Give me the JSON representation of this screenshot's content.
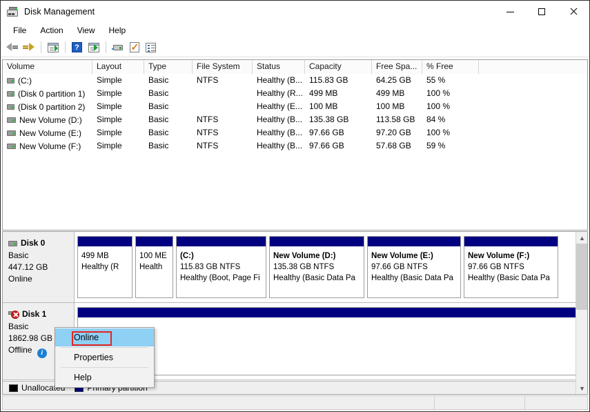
{
  "window": {
    "title": "Disk Management",
    "icon": "disk-management-icon",
    "buttons": {
      "minimize": "—",
      "maximize": "□",
      "close": "✕"
    }
  },
  "menubar": {
    "items": [
      "File",
      "Action",
      "View",
      "Help"
    ]
  },
  "toolbar": {
    "items": [
      {
        "name": "back-arrow-icon",
        "label": "Back"
      },
      {
        "name": "forward-arrow-icon",
        "label": "Forward"
      },
      {
        "name": "up-one-level-icon",
        "label": "Up One Level"
      },
      {
        "name": "help-icon",
        "label": "?"
      },
      {
        "name": "show-hide-console-tree-icon",
        "label": "Show/Hide Console Tree"
      },
      {
        "name": "disk-icon",
        "label": "Disk"
      },
      {
        "name": "rescan-disks-icon",
        "label": "Rescan Disks"
      },
      {
        "name": "properties-icon",
        "label": "Properties"
      }
    ]
  },
  "volume_list": {
    "columns": [
      "Volume",
      "Layout",
      "Type",
      "File System",
      "Status",
      "Capacity",
      "Free Spa...",
      "% Free",
      ""
    ],
    "rows": [
      {
        "volume": "(C:)",
        "layout": "Simple",
        "type": "Basic",
        "fs": "NTFS",
        "status": "Healthy (B...",
        "capacity": "115.83 GB",
        "free": "64.25 GB",
        "pct": "55 %"
      },
      {
        "volume": "(Disk 0 partition 1)",
        "layout": "Simple",
        "type": "Basic",
        "fs": "",
        "status": "Healthy (R...",
        "capacity": "499 MB",
        "free": "499 MB",
        "pct": "100 %"
      },
      {
        "volume": "(Disk 0 partition 2)",
        "layout": "Simple",
        "type": "Basic",
        "fs": "",
        "status": "Healthy (E...",
        "capacity": "100 MB",
        "free": "100 MB",
        "pct": "100 %"
      },
      {
        "volume": "New Volume (D:)",
        "layout": "Simple",
        "type": "Basic",
        "fs": "NTFS",
        "status": "Healthy (B...",
        "capacity": "135.38 GB",
        "free": "113.58 GB",
        "pct": "84 %"
      },
      {
        "volume": "New Volume (E:)",
        "layout": "Simple",
        "type": "Basic",
        "fs": "NTFS",
        "status": "Healthy (B...",
        "capacity": "97.66 GB",
        "free": "97.20 GB",
        "pct": "100 %"
      },
      {
        "volume": "New Volume (F:)",
        "layout": "Simple",
        "type": "Basic",
        "fs": "NTFS",
        "status": "Healthy (B...",
        "capacity": "97.66 GB",
        "free": "57.68 GB",
        "pct": "59 %"
      }
    ]
  },
  "graphical_view": {
    "disks": [
      {
        "name": "Disk 0",
        "type": "Basic",
        "size": "447.12 GB",
        "state": "Online",
        "icon": "disk-icon",
        "partitions": [
          {
            "name": "",
            "size": "499 MB",
            "status": "Healthy (R"
          },
          {
            "name": "",
            "size": "100 ME",
            "status": "Health"
          },
          {
            "name": "(C:)",
            "size": "115.83 GB NTFS",
            "status": "Healthy (Boot, Page Fi"
          },
          {
            "name": "New Volume  (D:)",
            "size": "135.38 GB NTFS",
            "status": "Healthy (Basic Data Pa"
          },
          {
            "name": "New Volume  (E:)",
            "size": "97.66 GB NTFS",
            "status": "Healthy (Basic Data Pa"
          },
          {
            "name": "New Volume  (F:)",
            "size": "97.66 GB NTFS",
            "status": "Healthy (Basic Data Pa"
          }
        ]
      },
      {
        "name": "Disk 1",
        "type": "Basic",
        "size": "1862.98 GB",
        "state": "Offline",
        "icon": "disk-error-icon",
        "state_icon": "info-icon",
        "partitions": [
          {
            "name": "",
            "size": "",
            "status": ""
          }
        ]
      }
    ],
    "legend": [
      {
        "label": "Unallocated",
        "color": "#000000"
      },
      {
        "label": "Primary partition",
        "color": "#000080"
      }
    ],
    "scrollbar": {
      "up": "▲",
      "down": "▼"
    }
  },
  "context_menu": {
    "items": [
      "Online",
      "Properties",
      "Help"
    ],
    "selected": "Online",
    "highlight_color": "#e8221c",
    "selection_color": "#8fd0f5"
  },
  "statusbar": {
    "panes": [
      "",
      "",
      ""
    ]
  }
}
